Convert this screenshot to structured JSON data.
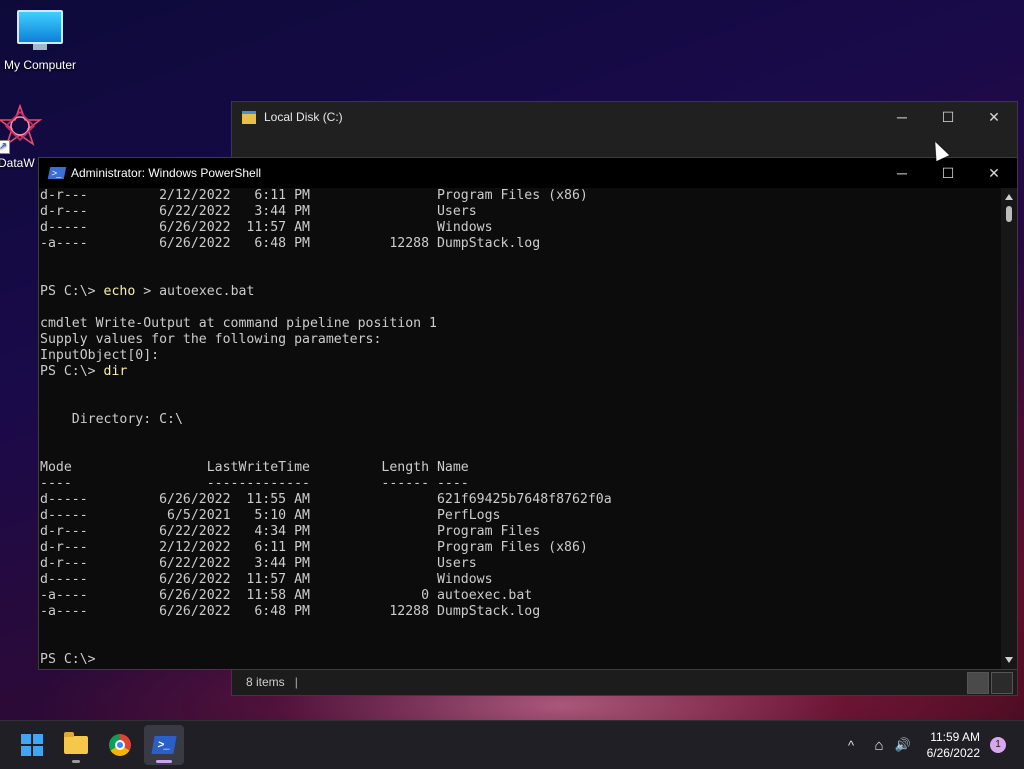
{
  "desktop": {
    "icons": [
      {
        "label": "My Computer",
        "icon": "monitor-icon"
      },
      {
        "label": "DataW",
        "icon": "datawrapper-icon"
      }
    ]
  },
  "explorer": {
    "title": "Local Disk (C:)",
    "status_items": "8 items",
    "status_sep": "|",
    "buttons": {
      "minimize": "─",
      "maximize": "☐",
      "close": "✕"
    }
  },
  "powershell": {
    "title": "Administrator: Windows PowerShell",
    "buttons": {
      "minimize": "─",
      "maximize": "☐",
      "close": "✕"
    },
    "lines": [
      {
        "text": "d-r---         2/12/2022   6:11 PM                Program Files (x86)"
      },
      {
        "text": "d-r---         6/22/2022   3:44 PM                Users"
      },
      {
        "text": "d-----         6/26/2022  11:57 AM                Windows"
      },
      {
        "text": "-a----         6/26/2022   6:48 PM          12288 DumpStack.log"
      },
      {
        "text": ""
      },
      {
        "text": ""
      },
      {
        "prompt": "PS C:\\> ",
        "cmd": "echo",
        "text": " > autoexec.bat"
      },
      {
        "text": ""
      },
      {
        "text": "cmdlet Write-Output at command pipeline position 1"
      },
      {
        "text": "Supply values for the following parameters:"
      },
      {
        "text": "InputObject[0]:"
      },
      {
        "prompt": "PS C:\\> ",
        "cmd": "dir",
        "text": ""
      },
      {
        "text": ""
      },
      {
        "text": ""
      },
      {
        "text": "    Directory: C:\\"
      },
      {
        "text": ""
      },
      {
        "text": ""
      },
      {
        "text": "Mode                 LastWriteTime         Length Name"
      },
      {
        "text": "----                 -------------         ------ ----"
      },
      {
        "text": "d-----         6/26/2022  11:55 AM                621f69425b7648f8762f0a"
      },
      {
        "text": "d-----          6/5/2021   5:10 AM                PerfLogs"
      },
      {
        "text": "d-r---         6/22/2022   4:34 PM                Program Files"
      },
      {
        "text": "d-r---         2/12/2022   6:11 PM                Program Files (x86)"
      },
      {
        "text": "d-r---         6/22/2022   3:44 PM                Users"
      },
      {
        "text": "d-----         6/26/2022  11:57 AM                Windows"
      },
      {
        "text": "-a----         6/26/2022  11:58 AM              0 autoexec.bat"
      },
      {
        "text": "-a----         6/26/2022   6:48 PM          12288 DumpStack.log"
      },
      {
        "text": ""
      },
      {
        "text": ""
      },
      {
        "prompt": "PS C:\\> ",
        "cmd": "",
        "text": ""
      }
    ]
  },
  "taskbar": {
    "apps": [
      {
        "name": "start",
        "icon": "windows-logo-icon"
      },
      {
        "name": "file-explorer",
        "icon": "folder-icon"
      },
      {
        "name": "chrome",
        "icon": "chrome-icon"
      },
      {
        "name": "powershell",
        "icon": "powershell-icon"
      }
    ],
    "tray": {
      "chevron": "^",
      "network": "⌂",
      "volume": "🔊"
    },
    "time": "11:59 AM",
    "date": "6/26/2022",
    "notification_count": "1"
  },
  "colors": {
    "console_text": "#cccccc",
    "console_command": "#f9f1a5",
    "console_bg": "#0c0c0c",
    "accent": "#c8a2f0"
  }
}
